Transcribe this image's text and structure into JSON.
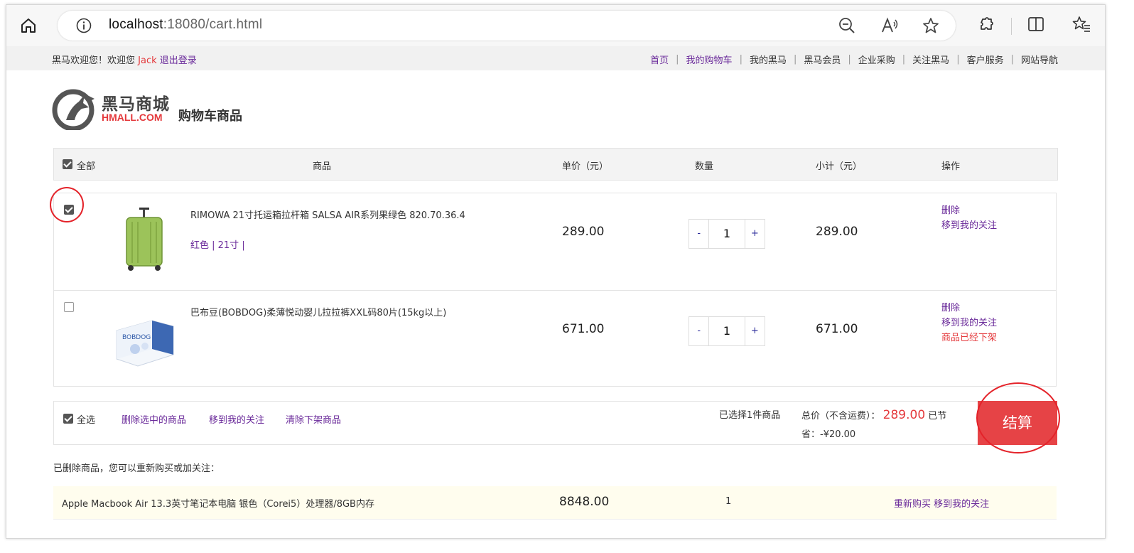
{
  "browser": {
    "url_host": "localhost",
    "url_rest": ":18080/cart.html"
  },
  "topbar": {
    "welcome": "黑马欢迎您！欢迎您",
    "username": "Jack",
    "logout": "退出登录",
    "nav": [
      {
        "label": "首页",
        "highlight": true
      },
      {
        "label": "我的购物车",
        "highlight": true
      },
      {
        "label": "我的黑马",
        "highlight": false
      },
      {
        "label": "黑马会员",
        "highlight": false
      },
      {
        "label": "企业采购",
        "highlight": false
      },
      {
        "label": "关注黑马",
        "highlight": false
      },
      {
        "label": "客户服务",
        "highlight": false
      },
      {
        "label": "网站导航",
        "highlight": false
      }
    ]
  },
  "header": {
    "logo_text": "黑马商城",
    "logo_sub": "HMALL.COM",
    "page_title": "购物车商品"
  },
  "table_header": {
    "all": "全部",
    "product": "商品",
    "price": "单价（元）",
    "qty": "数量",
    "subtotal": "小计（元）",
    "ops": "操作"
  },
  "items": [
    {
      "checked": true,
      "name": "RIMOWA 21寸托运箱拉杆箱 SALSA AIR系列果绿色 820.70.36.4",
      "attrs": "红色 | 21寸 |",
      "price": "289.00",
      "qty": "1",
      "subtotal": "289.00",
      "ops": [
        "删除",
        "移到我的关注"
      ],
      "status": "",
      "thumb": "suitcase"
    },
    {
      "checked": false,
      "name": "巴布豆(BOBDOG)柔薄悦动婴儿拉拉裤XXL码80片(15kg以上)",
      "attrs": "",
      "price": "671.00",
      "qty": "1",
      "subtotal": "671.00",
      "ops": [
        "删除",
        "移到我的关注"
      ],
      "status": "商品已经下架",
      "thumb": "diaper-box"
    }
  ],
  "qty_controls": {
    "minus": "-",
    "plus": "+"
  },
  "footer": {
    "select_all": "全选",
    "delete_selected": "删除选中的商品",
    "move_to_follow": "移到我的关注",
    "clear_offline": "清除下架商品",
    "selected_count": "已选择1件商品",
    "total_label": "总价（不含运费）：",
    "total_amount": "289.00",
    "saved_prefix": "已节",
    "saved_rest": "省：-¥20.00",
    "checkout": "结算"
  },
  "deleted": {
    "title": "已删除商品，您可以重新购买或加关注：",
    "items": [
      {
        "name": "Apple Macbook Air 13.3英寸笔记本电脑 银色（Corei5）处理器/8GB内存",
        "price": "8848.00",
        "qty": "1",
        "ops": "重新购买 移到我的关注"
      }
    ]
  },
  "colors": {
    "accent_red": "#e4393c",
    "link_purple": "#6a2a9a",
    "checkout_bg": "#e64346",
    "annotation": "#e4232a"
  }
}
